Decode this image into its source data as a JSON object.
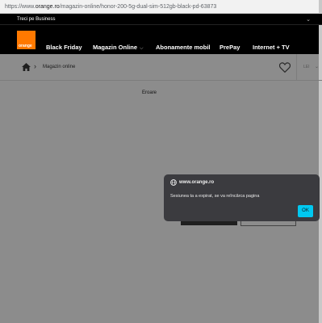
{
  "browser": {
    "url_prefix": "https://www.",
    "url_host": "orange.ro",
    "url_path": "/magazin-online/honor-200-5g-dual-sim-512gb-black-pd-63873"
  },
  "topbar": {
    "label": "Treci pe Business"
  },
  "header": {
    "logo_text": "orange",
    "nav_items": [
      "Black Friday",
      "Magazin Online",
      "Abonamente mobil",
      "PrePay",
      "Internet + TV"
    ]
  },
  "breadcrumb": {
    "label": "Magazin online"
  },
  "account": {
    "label": "LEI"
  },
  "main": {
    "error_text": "Eroare"
  },
  "dialog": {
    "site": "www.orange.ro",
    "message": "Sesiunea ta a expirat, se va reîncărca pagina",
    "ok_label": "OK"
  },
  "colors": {
    "brand": "#ff7900",
    "dialog_bg": "#3b3b3f",
    "ok_button": "#00c8f0",
    "overlay": "#8c8c8c"
  }
}
